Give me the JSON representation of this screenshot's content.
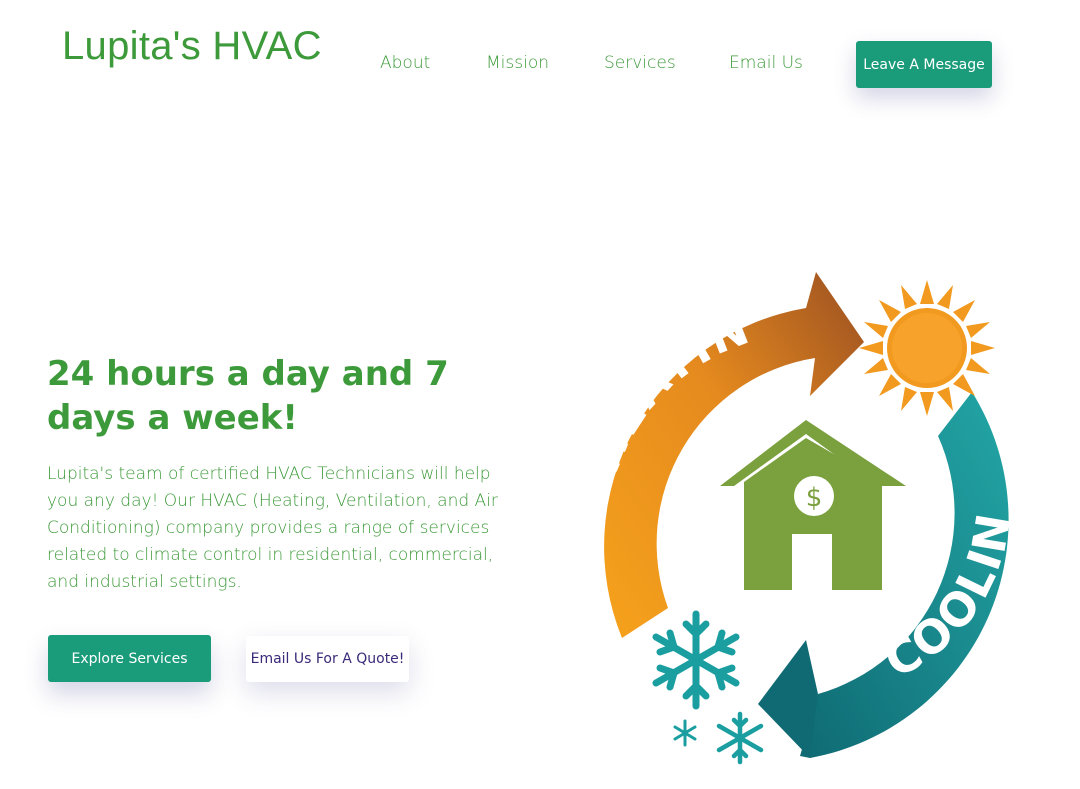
{
  "header": {
    "logo": "Lupita's HVAC",
    "nav": [
      {
        "label": "About"
      },
      {
        "label": "Mission"
      },
      {
        "label": "Services"
      },
      {
        "label": "Email Us"
      }
    ],
    "cta": "Leave A Message"
  },
  "hero": {
    "title": "24 hours a day and 7 days a week!",
    "description": "Lupita's team of certified HVAC Technicians will help you any day! Our HVAC (Heating, Ventilation, and Air Conditioning) company provides a range of services related to climate control in residential, commercial, and industrial settings.",
    "primary_button": "Explore Services",
    "secondary_button": "Email Us For A Quote!"
  },
  "illustration": {
    "heating_label": "HEATING",
    "cooling_label": "COOLING",
    "currency_symbol": "$",
    "icons": [
      "sun-icon",
      "house-icon",
      "snowflake-icon"
    ]
  },
  "colors": {
    "brand_green": "#3d9a3a",
    "button_teal": "#1a9b7a",
    "heating_orange": "#f29a1f",
    "heating_brown": "#9a4f22",
    "cooling_teal": "#1a9ea0",
    "house_green": "#7ba03e"
  }
}
